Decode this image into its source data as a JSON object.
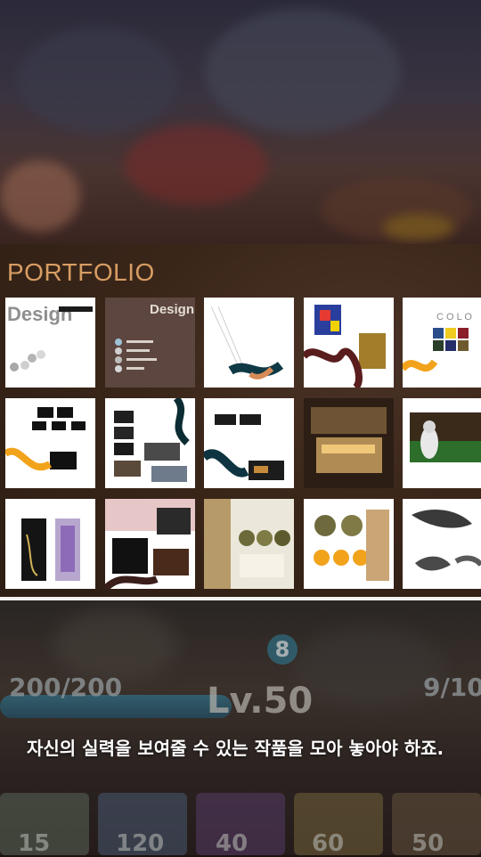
{
  "portfolio": {
    "title": "PORTFOLIO"
  },
  "thumbnails": [
    {
      "label": "Design"
    },
    {
      "label": "Design"
    },
    {
      "label": ""
    },
    {
      "label": ""
    },
    {
      "label": "C O L O"
    },
    {
      "label": ""
    },
    {
      "label": ""
    },
    {
      "label": ""
    },
    {
      "label": ""
    },
    {
      "label": ""
    },
    {
      "label": ""
    },
    {
      "label": ""
    },
    {
      "label": ""
    },
    {
      "label": ""
    },
    {
      "label": ""
    }
  ],
  "game": {
    "hp_left": "200/200",
    "hp_right": "9/10",
    "level": "Lv.50",
    "badge": "8",
    "cards": [
      "15",
      "120",
      "40",
      "60",
      "50"
    ]
  },
  "caption": "자신의 실력을 보여줄 수 있는 작품을 모아 놓아야 하죠."
}
